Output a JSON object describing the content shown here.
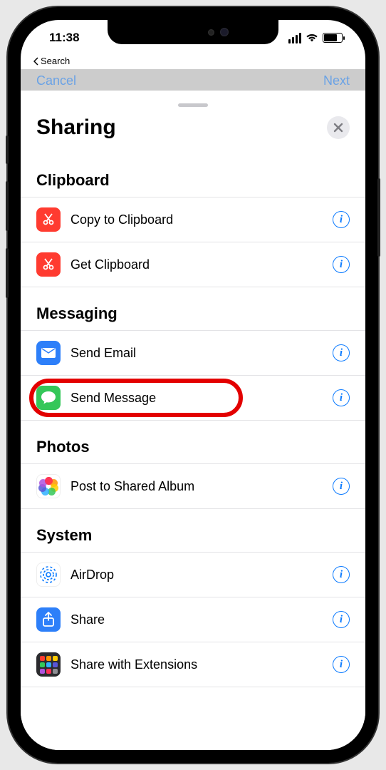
{
  "status": {
    "time": "11:38",
    "back_label": "Search"
  },
  "background_nav": {
    "left": "Cancel",
    "right": "Next"
  },
  "sheet": {
    "title": "Sharing"
  },
  "sections": [
    {
      "title": "Clipboard",
      "items": [
        {
          "label": "Copy to Clipboard",
          "icon": "scissors-icon"
        },
        {
          "label": "Get Clipboard",
          "icon": "scissors-icon"
        }
      ]
    },
    {
      "title": "Messaging",
      "items": [
        {
          "label": "Send Email",
          "icon": "envelope-icon"
        },
        {
          "label": "Send Message",
          "icon": "message-bubble-icon",
          "highlighted": true
        }
      ]
    },
    {
      "title": "Photos",
      "items": [
        {
          "label": "Post to Shared Album",
          "icon": "photos-flower-icon"
        }
      ]
    },
    {
      "title": "System",
      "items": [
        {
          "label": "AirDrop",
          "icon": "airdrop-icon"
        },
        {
          "label": "Share",
          "icon": "share-arrow-icon"
        },
        {
          "label": "Share with Extensions",
          "icon": "extensions-grid-icon"
        }
      ]
    }
  ]
}
